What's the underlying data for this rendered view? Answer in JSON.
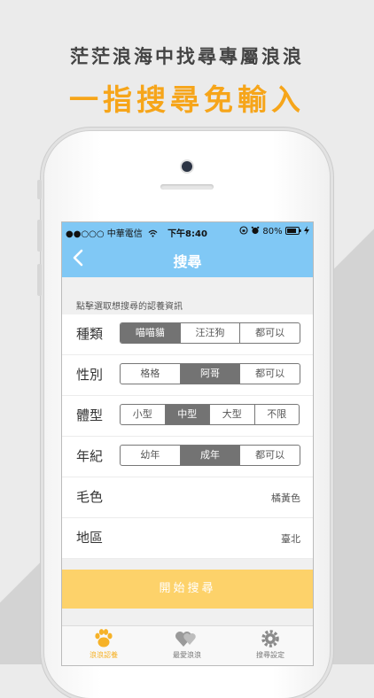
{
  "promo": {
    "line1": "茫茫浪海中找尋專屬浪浪",
    "line2": "一指搜尋免輸入"
  },
  "status_bar": {
    "carrier": "●●○○○ 中華電信",
    "time": "下午8:40",
    "battery": "80%"
  },
  "nav": {
    "title": "搜尋"
  },
  "form": {
    "hint": "點擊選取想搜尋的認養資訊",
    "species": {
      "label": "種類",
      "options": [
        "喵喵貓",
        "汪汪狗",
        "都可以"
      ],
      "selected": 0
    },
    "gender": {
      "label": "性別",
      "options": [
        "格格",
        "阿哥",
        "都可以"
      ],
      "selected": 1
    },
    "size": {
      "label": "體型",
      "options": [
        "小型",
        "中型",
        "大型",
        "不限"
      ],
      "selected": 1
    },
    "age": {
      "label": "年紀",
      "options": [
        "幼年",
        "成年",
        "都可以"
      ],
      "selected": 1
    },
    "color": {
      "label": "毛色",
      "value": "橘黃色"
    },
    "region": {
      "label": "地區",
      "value": "臺北"
    }
  },
  "start_button": "開始搜尋",
  "tabs": [
    "浪浪認養",
    "最愛浪浪",
    "搜尋設定"
  ],
  "colors": {
    "accent": "#80c8f5",
    "promo_orange": "#f6a51a",
    "button_yellow": "#fdd26a",
    "segment_selected": "#737373"
  }
}
